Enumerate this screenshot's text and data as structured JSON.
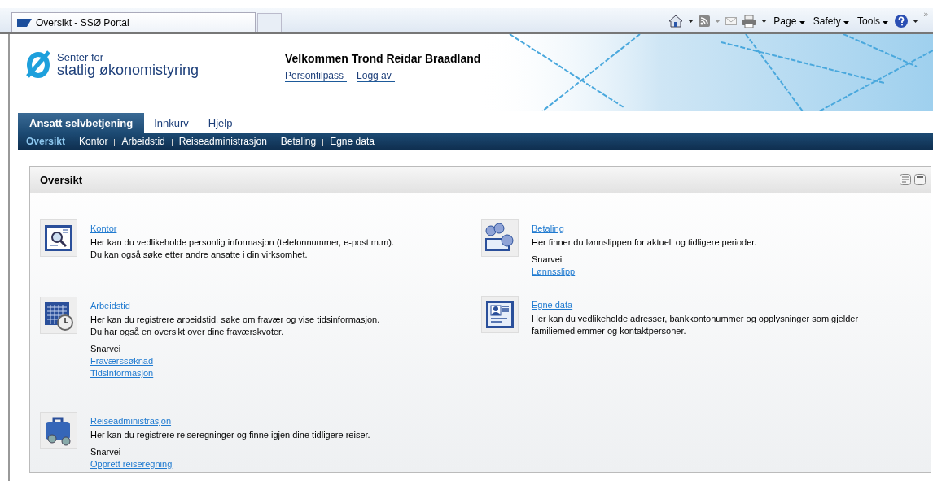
{
  "browser": {
    "tab_title": "Oversikt - SSØ Portal",
    "menus": [
      "Page",
      "Safety",
      "Tools"
    ],
    "overflow": "»"
  },
  "header": {
    "logo": [
      "Senter for",
      "statlig økonomistyring"
    ],
    "welcome": "Velkommen Trond Reidar Braadland",
    "links": [
      "Persontilpass",
      "Logg av"
    ]
  },
  "tabs": [
    {
      "label": "Ansatt selvbetjening",
      "selected": true
    },
    {
      "label": "Innkurv",
      "selected": false
    },
    {
      "label": "Hjelp",
      "selected": false
    }
  ],
  "subnav": [
    {
      "label": "Oversikt",
      "selected": true
    },
    {
      "label": "Kontor",
      "selected": false
    },
    {
      "label": "Arbeidstid",
      "selected": false
    },
    {
      "label": "Reiseadministrasjon",
      "selected": false
    },
    {
      "label": "Betaling",
      "selected": false
    },
    {
      "label": "Egne data",
      "selected": false
    }
  ],
  "panel": {
    "title": "Oversikt",
    "columns": [
      [
        {
          "kind": "person-search",
          "title": "Kontor",
          "description": [
            "Her kan du vedlikeholde personlig informasjon (telefonnummer, e-post m.m).",
            "Du kan også søke etter andre ansatte i din virksomhet."
          ]
        },
        {
          "kind": "calendar",
          "title": "Arbeidstid",
          "description": [
            "Her kan du registrere arbeidstid, søke om fravær og vise tidsinformasjon.",
            "Du har også en oversikt over dine fraværskvoter."
          ],
          "shortcut_label": "Snarvei",
          "shortcuts": [
            "Fraværssøknad",
            "Tidsinformasjon"
          ]
        },
        {
          "kind": "suitcase",
          "title": "Reiseadministrasjon",
          "description": [
            "Her kan du registrere reiseregninger og finne igjen dine tidligere reiser."
          ],
          "shortcut_label": "Snarvei",
          "shortcuts": [
            "Opprett reiseregning"
          ]
        }
      ],
      [
        {
          "kind": "coins",
          "title": "Betaling",
          "description": [
            "Her finner du lønnslippen for aktuell og tidligere perioder."
          ],
          "shortcut_label": "Snarvei",
          "shortcuts": [
            "Lønnsslipp"
          ]
        },
        {
          "kind": "id-card",
          "title": "Egne data",
          "description": [
            "Her kan du vedlikeholde adresser, bankkontonummer og opplysninger som gjelder",
            "familiemedlemmer og kontaktpersoner."
          ]
        }
      ]
    ]
  }
}
